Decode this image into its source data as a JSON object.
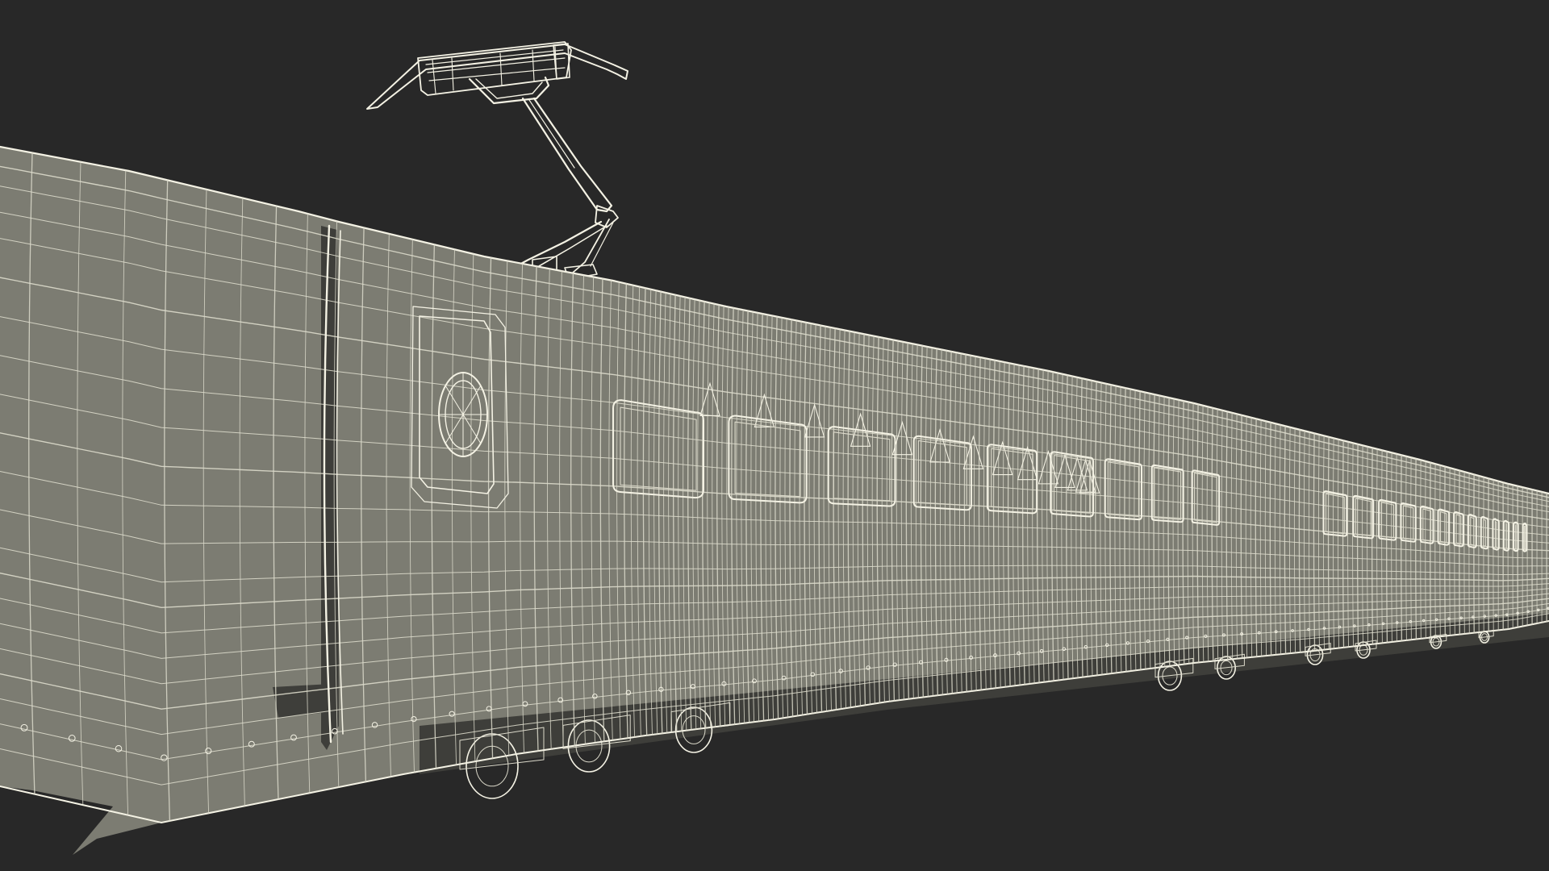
{
  "scene": {
    "subject": "high-speed-train-wireframe",
    "render_style": "wireframe",
    "colors": {
      "background": "#282828",
      "body_fill": "#7c7c72",
      "body_fill_dark": "#6a6a62",
      "shadow_fill": "#3e3e3a",
      "wire": "#f4f2e4",
      "wire_dim": "#dcdacb"
    }
  }
}
